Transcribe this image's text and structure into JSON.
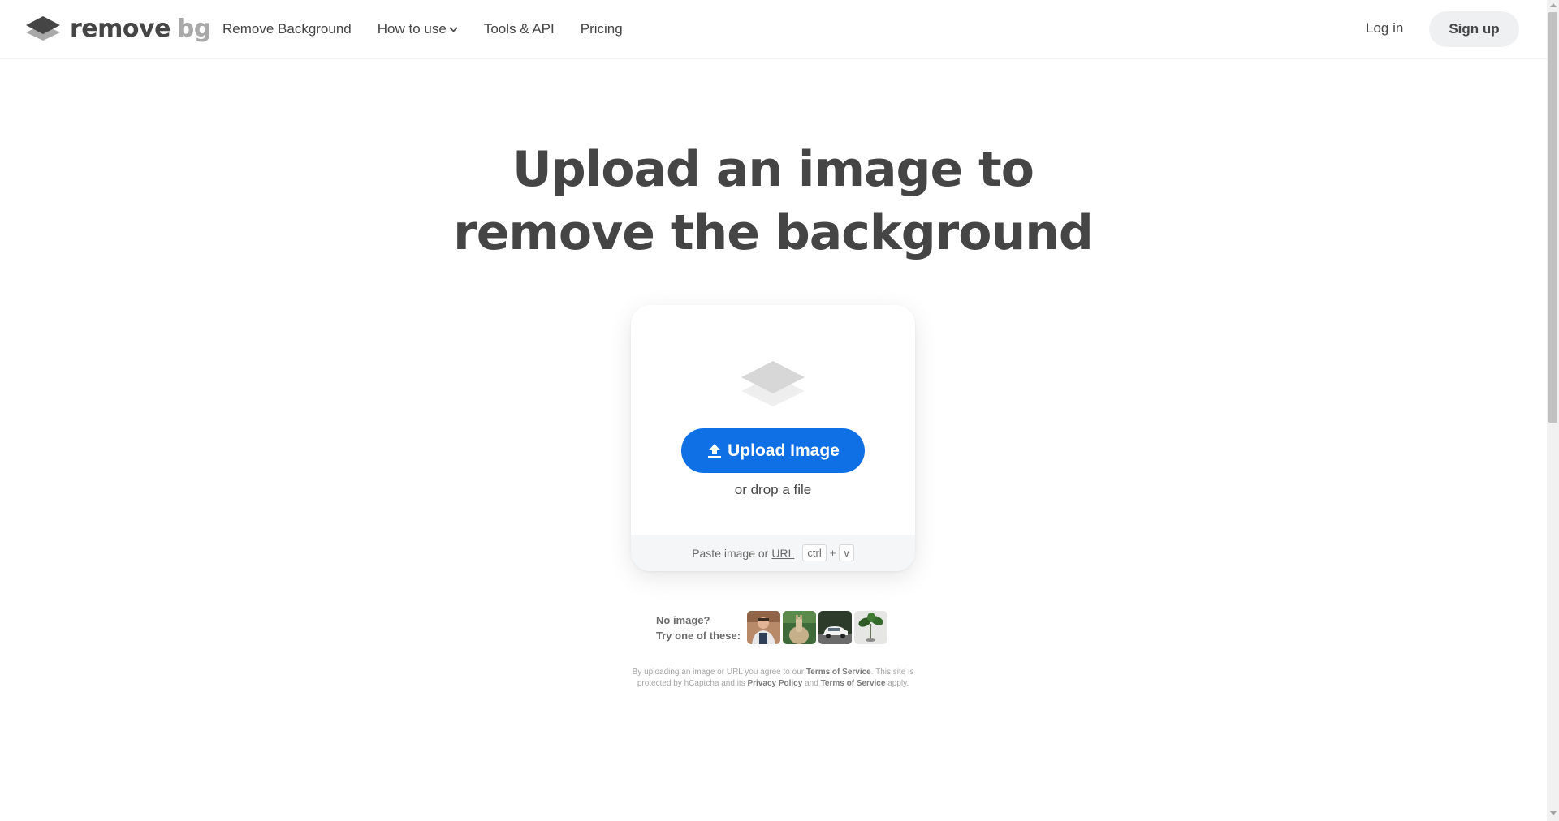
{
  "header": {
    "logo": {
      "remove": "remove",
      "bg": "bg"
    },
    "nav": [
      {
        "label": "Remove Background"
      },
      {
        "label": "How to use"
      },
      {
        "label": "Tools & API"
      },
      {
        "label": "Pricing"
      }
    ],
    "login_label": "Log in",
    "signup_label": "Sign up"
  },
  "hero": {
    "title_line1": "Upload an image to",
    "title_line2": "remove the background"
  },
  "upload": {
    "button_label": "Upload Image",
    "drop_text": "or drop a file",
    "paste_text": "Paste image or",
    "url_label": "URL",
    "kbd_ctrl": "ctrl",
    "kbd_plus": "+",
    "kbd_v": "v"
  },
  "samples": {
    "line1": "No image?",
    "line2": "Try one of these:",
    "thumbs": [
      "person",
      "llama",
      "car",
      "plant"
    ]
  },
  "legal": {
    "t1": "By uploading an image or URL you agree to our",
    "tos": "Terms of Service",
    "t2": ". This site is protected by hCaptcha and its",
    "privacy": "Privacy Policy",
    "t3": "and",
    "tos2": "Terms of Service",
    "t4": "apply."
  },
  "colors": {
    "accent": "#0f70e6",
    "text": "#454545",
    "logo_bg": "#a9a9a9"
  }
}
